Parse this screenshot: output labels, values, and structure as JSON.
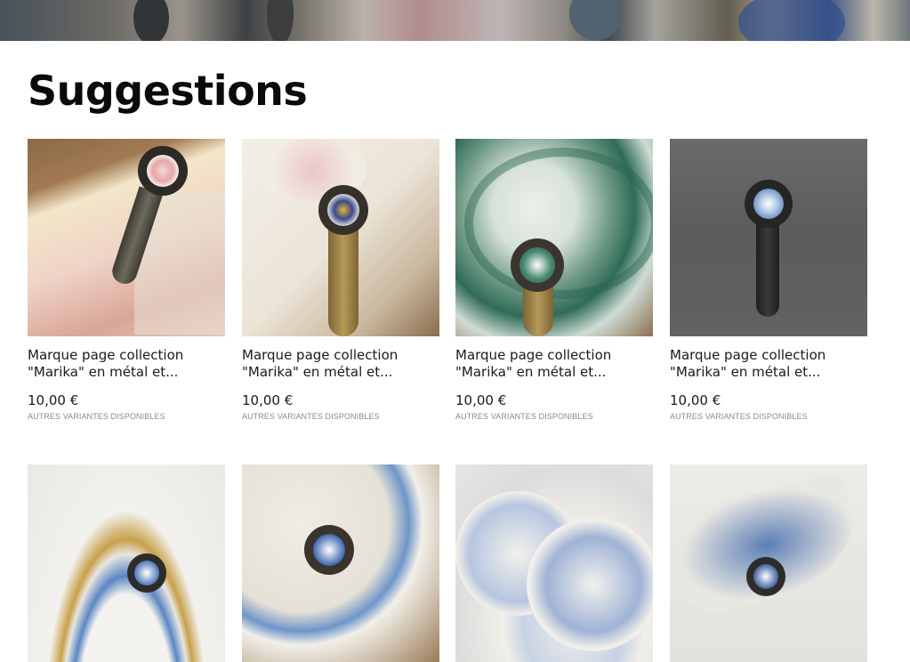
{
  "page": {
    "title": "Suggestions"
  },
  "products": [
    {
      "name": "Marque page collection \"Marika\" en métal et...",
      "price": "10,00 €",
      "variants": "AUTRES VARIANTES DISPONIBLES"
    },
    {
      "name": "Marque page collection \"Marika\" en métal et...",
      "price": "10,00 €",
      "variants": "AUTRES VARIANTES DISPONIBLES"
    },
    {
      "name": "Marque page collection \"Marika\" en métal et...",
      "price": "10,00 €",
      "variants": "AUTRES VARIANTES DISPONIBLES"
    },
    {
      "name": "Marque page collection \"Marika\" en métal et...",
      "price": "10,00 €",
      "variants": "AUTRES VARIANTES DISPONIBLES"
    }
  ],
  "colors": {
    "text": "#111111",
    "muted": "#8a8a8a",
    "background": "#ffffff"
  }
}
